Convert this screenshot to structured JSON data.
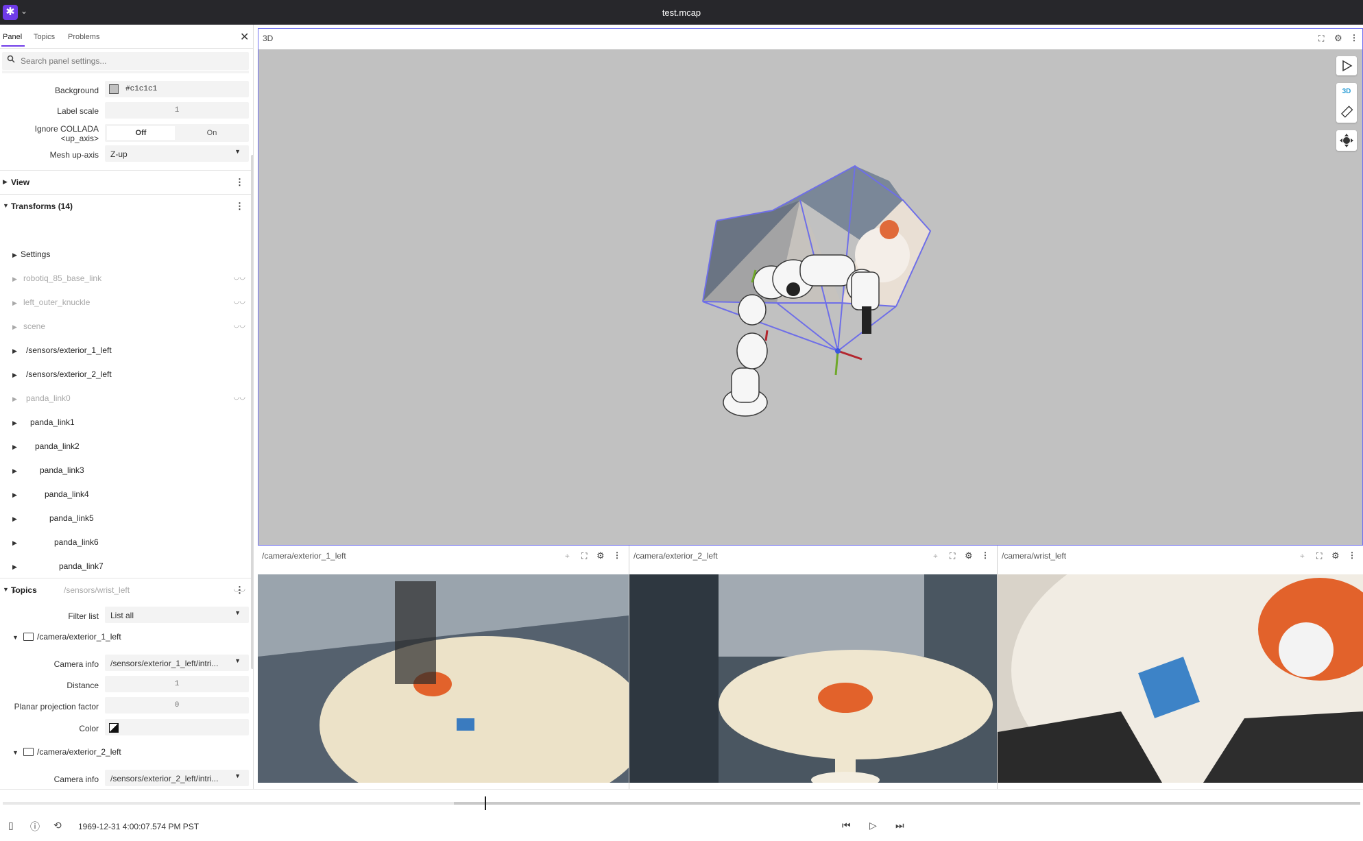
{
  "app": {
    "title": "test.mcap",
    "logo_glyph": "✱",
    "accent_color": "#6f3be8"
  },
  "sidebar": {
    "tabs": [
      "Panel",
      "Topics",
      "Problems"
    ],
    "search_placeholder": "Search panel settings...",
    "scene_settings": {
      "background_label": "Background",
      "background_value": "#c1c1c1",
      "label_scale_label": "Label scale",
      "label_scale_value": "1",
      "ignore_collada_label_1": "Ignore COLLADA",
      "ignore_collada_label_2": "<up_axis>",
      "toggle_off": "Off",
      "toggle_on": "On",
      "mesh_up_axis_label": "Mesh up-axis",
      "mesh_up_axis_value": "Z-up"
    },
    "view_section": "View",
    "transforms_section": "Transforms (14)",
    "transforms": [
      {
        "label": "Settings",
        "dim": false
      },
      {
        "label": "robotiq_85_base_link",
        "dim": true
      },
      {
        "label": "left_outer_knuckle",
        "dim": true
      },
      {
        "label": "scene",
        "dim": true
      },
      {
        "label": "/sensors/exterior_1_left",
        "dim": false
      },
      {
        "label": "/sensors/exterior_2_left",
        "dim": false
      },
      {
        "label": "panda_link0",
        "dim": true
      },
      {
        "label": "panda_link1",
        "dim": false
      },
      {
        "label": "panda_link2",
        "dim": false
      },
      {
        "label": "panda_link3",
        "dim": false
      },
      {
        "label": "panda_link4",
        "dim": false
      },
      {
        "label": "panda_link5",
        "dim": false
      },
      {
        "label": "panda_link6",
        "dim": false
      },
      {
        "label": "panda_link7",
        "dim": false
      },
      {
        "label": "/sensors/wrist_left",
        "dim": true
      }
    ],
    "topics_section": "Topics",
    "filter_list_label": "Filter list",
    "filter_list_value": "List all",
    "topic_1": {
      "name": "/camera/exterior_1_left",
      "camera_info_label": "Camera info",
      "camera_info_value": "/sensors/exterior_1_left/intri...",
      "distance_label": "Distance",
      "distance_value": "1",
      "planar_label": "Planar projection factor",
      "planar_value": "0",
      "color_label": "Color"
    },
    "topic_2": {
      "name": "/camera/exterior_2_left",
      "camera_info_label": "Camera info",
      "camera_info_value": "/sensors/exterior_2_left/intri..."
    }
  },
  "panel3d": {
    "title": "3D",
    "mode_label": "3D"
  },
  "image_panels": [
    {
      "title": "/camera/exterior_1_left"
    },
    {
      "title": "/camera/exterior_2_left"
    },
    {
      "title": "/camera/wrist_left"
    }
  ],
  "playback": {
    "timestamp": "1969-12-31 4:00:07.574 PM PST",
    "progress": 0.28
  }
}
